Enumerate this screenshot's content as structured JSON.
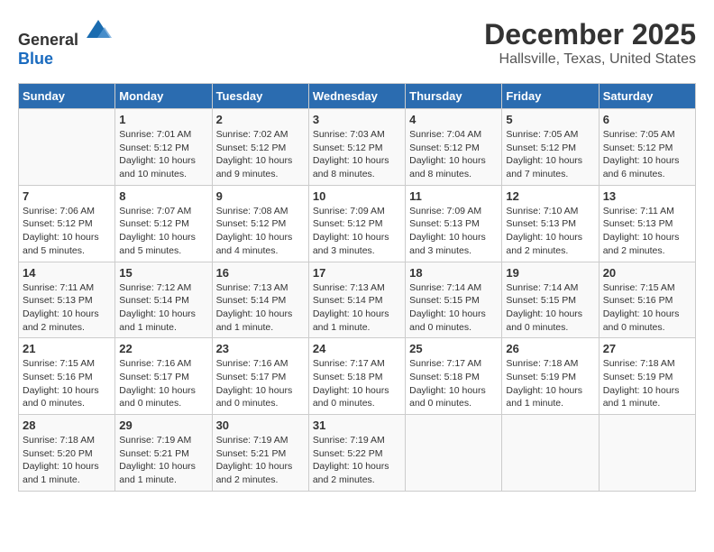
{
  "header": {
    "logo_general": "General",
    "logo_blue": "Blue",
    "title": "December 2025",
    "subtitle": "Hallsville, Texas, United States"
  },
  "days_of_week": [
    "Sunday",
    "Monday",
    "Tuesday",
    "Wednesday",
    "Thursday",
    "Friday",
    "Saturday"
  ],
  "weeks": [
    [
      {
        "day": "",
        "sunrise": "",
        "sunset": "",
        "daylight": ""
      },
      {
        "day": "1",
        "sunrise": "Sunrise: 7:01 AM",
        "sunset": "Sunset: 5:12 PM",
        "daylight": "Daylight: 10 hours and 10 minutes."
      },
      {
        "day": "2",
        "sunrise": "Sunrise: 7:02 AM",
        "sunset": "Sunset: 5:12 PM",
        "daylight": "Daylight: 10 hours and 9 minutes."
      },
      {
        "day": "3",
        "sunrise": "Sunrise: 7:03 AM",
        "sunset": "Sunset: 5:12 PM",
        "daylight": "Daylight: 10 hours and 8 minutes."
      },
      {
        "day": "4",
        "sunrise": "Sunrise: 7:04 AM",
        "sunset": "Sunset: 5:12 PM",
        "daylight": "Daylight: 10 hours and 8 minutes."
      },
      {
        "day": "5",
        "sunrise": "Sunrise: 7:05 AM",
        "sunset": "Sunset: 5:12 PM",
        "daylight": "Daylight: 10 hours and 7 minutes."
      },
      {
        "day": "6",
        "sunrise": "Sunrise: 7:05 AM",
        "sunset": "Sunset: 5:12 PM",
        "daylight": "Daylight: 10 hours and 6 minutes."
      }
    ],
    [
      {
        "day": "7",
        "sunrise": "Sunrise: 7:06 AM",
        "sunset": "Sunset: 5:12 PM",
        "daylight": "Daylight: 10 hours and 5 minutes."
      },
      {
        "day": "8",
        "sunrise": "Sunrise: 7:07 AM",
        "sunset": "Sunset: 5:12 PM",
        "daylight": "Daylight: 10 hours and 5 minutes."
      },
      {
        "day": "9",
        "sunrise": "Sunrise: 7:08 AM",
        "sunset": "Sunset: 5:12 PM",
        "daylight": "Daylight: 10 hours and 4 minutes."
      },
      {
        "day": "10",
        "sunrise": "Sunrise: 7:09 AM",
        "sunset": "Sunset: 5:12 PM",
        "daylight": "Daylight: 10 hours and 3 minutes."
      },
      {
        "day": "11",
        "sunrise": "Sunrise: 7:09 AM",
        "sunset": "Sunset: 5:13 PM",
        "daylight": "Daylight: 10 hours and 3 minutes."
      },
      {
        "day": "12",
        "sunrise": "Sunrise: 7:10 AM",
        "sunset": "Sunset: 5:13 PM",
        "daylight": "Daylight: 10 hours and 2 minutes."
      },
      {
        "day": "13",
        "sunrise": "Sunrise: 7:11 AM",
        "sunset": "Sunset: 5:13 PM",
        "daylight": "Daylight: 10 hours and 2 minutes."
      }
    ],
    [
      {
        "day": "14",
        "sunrise": "Sunrise: 7:11 AM",
        "sunset": "Sunset: 5:13 PM",
        "daylight": "Daylight: 10 hours and 2 minutes."
      },
      {
        "day": "15",
        "sunrise": "Sunrise: 7:12 AM",
        "sunset": "Sunset: 5:14 PM",
        "daylight": "Daylight: 10 hours and 1 minute."
      },
      {
        "day": "16",
        "sunrise": "Sunrise: 7:13 AM",
        "sunset": "Sunset: 5:14 PM",
        "daylight": "Daylight: 10 hours and 1 minute."
      },
      {
        "day": "17",
        "sunrise": "Sunrise: 7:13 AM",
        "sunset": "Sunset: 5:14 PM",
        "daylight": "Daylight: 10 hours and 1 minute."
      },
      {
        "day": "18",
        "sunrise": "Sunrise: 7:14 AM",
        "sunset": "Sunset: 5:15 PM",
        "daylight": "Daylight: 10 hours and 0 minutes."
      },
      {
        "day": "19",
        "sunrise": "Sunrise: 7:14 AM",
        "sunset": "Sunset: 5:15 PM",
        "daylight": "Daylight: 10 hours and 0 minutes."
      },
      {
        "day": "20",
        "sunrise": "Sunrise: 7:15 AM",
        "sunset": "Sunset: 5:16 PM",
        "daylight": "Daylight: 10 hours and 0 minutes."
      }
    ],
    [
      {
        "day": "21",
        "sunrise": "Sunrise: 7:15 AM",
        "sunset": "Sunset: 5:16 PM",
        "daylight": "Daylight: 10 hours and 0 minutes."
      },
      {
        "day": "22",
        "sunrise": "Sunrise: 7:16 AM",
        "sunset": "Sunset: 5:17 PM",
        "daylight": "Daylight: 10 hours and 0 minutes."
      },
      {
        "day": "23",
        "sunrise": "Sunrise: 7:16 AM",
        "sunset": "Sunset: 5:17 PM",
        "daylight": "Daylight: 10 hours and 0 minutes."
      },
      {
        "day": "24",
        "sunrise": "Sunrise: 7:17 AM",
        "sunset": "Sunset: 5:18 PM",
        "daylight": "Daylight: 10 hours and 0 minutes."
      },
      {
        "day": "25",
        "sunrise": "Sunrise: 7:17 AM",
        "sunset": "Sunset: 5:18 PM",
        "daylight": "Daylight: 10 hours and 0 minutes."
      },
      {
        "day": "26",
        "sunrise": "Sunrise: 7:18 AM",
        "sunset": "Sunset: 5:19 PM",
        "daylight": "Daylight: 10 hours and 1 minute."
      },
      {
        "day": "27",
        "sunrise": "Sunrise: 7:18 AM",
        "sunset": "Sunset: 5:19 PM",
        "daylight": "Daylight: 10 hours and 1 minute."
      }
    ],
    [
      {
        "day": "28",
        "sunrise": "Sunrise: 7:18 AM",
        "sunset": "Sunset: 5:20 PM",
        "daylight": "Daylight: 10 hours and 1 minute."
      },
      {
        "day": "29",
        "sunrise": "Sunrise: 7:19 AM",
        "sunset": "Sunset: 5:21 PM",
        "daylight": "Daylight: 10 hours and 1 minute."
      },
      {
        "day": "30",
        "sunrise": "Sunrise: 7:19 AM",
        "sunset": "Sunset: 5:21 PM",
        "daylight": "Daylight: 10 hours and 2 minutes."
      },
      {
        "day": "31",
        "sunrise": "Sunrise: 7:19 AM",
        "sunset": "Sunset: 5:22 PM",
        "daylight": "Daylight: 10 hours and 2 minutes."
      },
      {
        "day": "",
        "sunrise": "",
        "sunset": "",
        "daylight": ""
      },
      {
        "day": "",
        "sunrise": "",
        "sunset": "",
        "daylight": ""
      },
      {
        "day": "",
        "sunrise": "",
        "sunset": "",
        "daylight": ""
      }
    ]
  ]
}
